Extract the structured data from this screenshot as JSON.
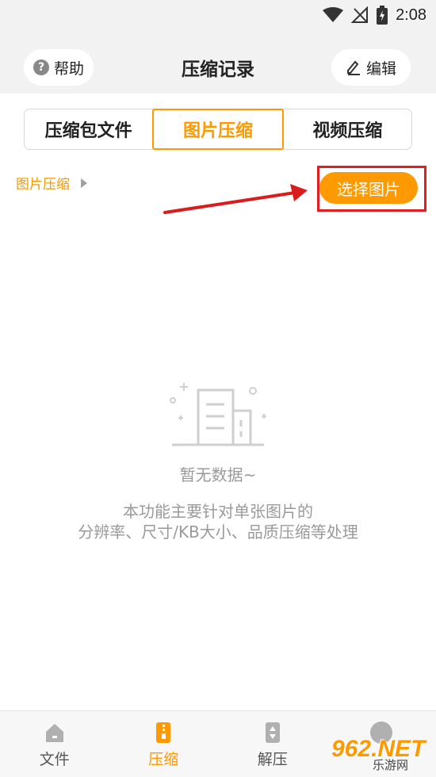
{
  "status_bar": {
    "time": "2:08",
    "icons": [
      "wifi-icon",
      "signal-off-icon",
      "battery-charging-icon"
    ]
  },
  "header": {
    "title": "压缩记录",
    "help_label": "帮助",
    "edit_label": "编辑"
  },
  "tabs": [
    {
      "label": "压缩包文件",
      "active": false
    },
    {
      "label": "图片压缩",
      "active": true
    },
    {
      "label": "视频压缩",
      "active": false
    }
  ],
  "breadcrumb": {
    "label": "图片压缩"
  },
  "select_button": {
    "label": "选择图片"
  },
  "empty_state": {
    "title": "暂无数据~",
    "description_line1": "本功能主要针对单张图片的",
    "description_line2": "分辨率、尺寸/KB大小、品质压缩等处理"
  },
  "bottom_nav": [
    {
      "label": "文件",
      "icon": "home-icon",
      "active": false
    },
    {
      "label": "压缩",
      "icon": "zip-icon",
      "active": true
    },
    {
      "label": "解压",
      "icon": "unzip-icon",
      "active": false
    }
  ],
  "watermark": {
    "big": "962.NET",
    "small": "乐游网"
  },
  "colors": {
    "accent": "#ff9900",
    "annotation_red": "#e02020",
    "muted_text": "#9a9a9a"
  }
}
